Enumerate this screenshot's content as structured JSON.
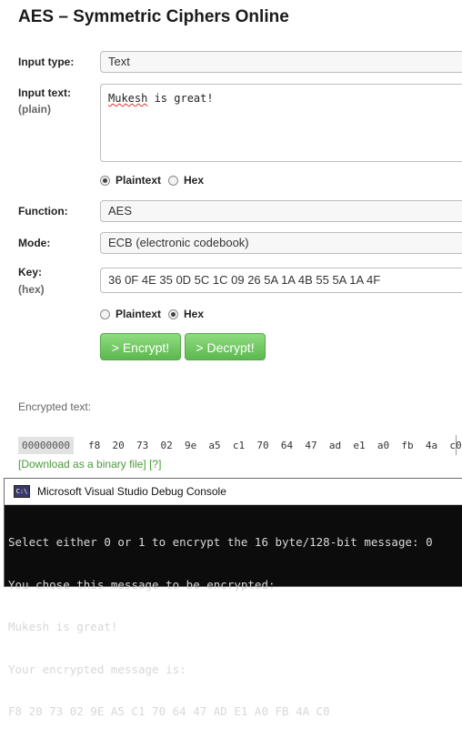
{
  "page": {
    "title": "AES – Symmetric Ciphers Online"
  },
  "form": {
    "input_type": {
      "label": "Input type:",
      "value": "Text"
    },
    "input_text": {
      "label": "Input text:",
      "sublabel": "(plain)",
      "value_word1": "Mukesh",
      "value_rest": " is great!"
    },
    "input_format": {
      "options": [
        "Plaintext",
        "Hex"
      ],
      "selected": "Plaintext"
    },
    "function": {
      "label": "Function:",
      "value": "AES"
    },
    "mode": {
      "label": "Mode:",
      "value": "ECB (electronic codebook)"
    },
    "key": {
      "label": "Key:",
      "sublabel": "(hex)",
      "value": "36 0F 4E 35 0D 5C 1C 09 26 5A 1A 4B 55 5A 1A 4F"
    },
    "key_format": {
      "options": [
        "Plaintext",
        "Hex"
      ],
      "selected": "Hex"
    },
    "buttons": {
      "encrypt": "> Encrypt!",
      "decrypt": "> Decrypt!"
    }
  },
  "output": {
    "label": "Encrypted text:",
    "offset": "00000000",
    "bytes": "f8  20  73  02  9e  a5  c1  70  64  47  ad  e1  a0  fb  4a  c0",
    "download_link": "[Download as a binary file]",
    "help_link": "[?]"
  },
  "console": {
    "title": "Microsoft Visual Studio Debug Console",
    "lines": [
      "Select either 0 or 1 to encrypt the 16 byte/128-bit message: 0",
      "You chose this message to be encrypted:",
      "Mukesh is great!",
      "Your encrypted message is:",
      "F8 20 73 02 9E A5 C1 70 64 47 AD E1 A0 FB 4A C0"
    ]
  }
}
